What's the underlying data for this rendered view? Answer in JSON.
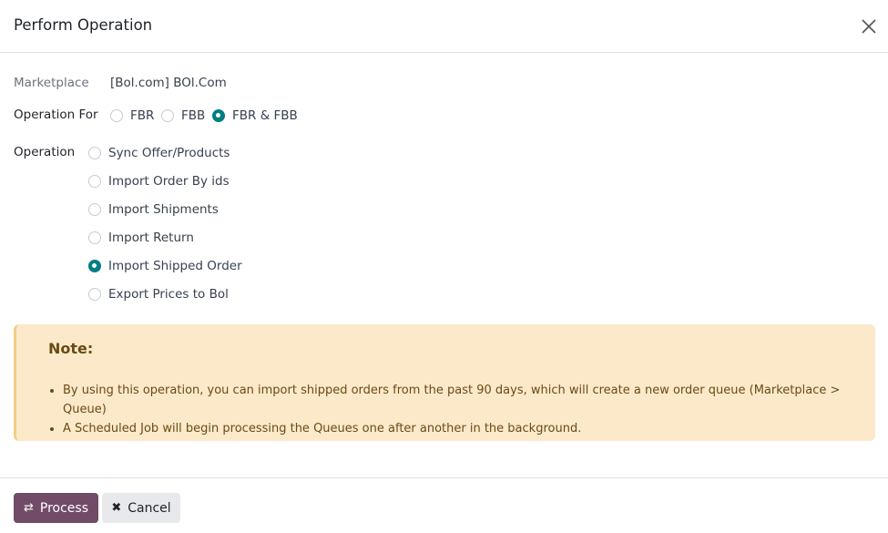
{
  "dialog": {
    "title": "Perform Operation",
    "close_icon": "close-icon"
  },
  "marketplace": {
    "label": "Marketplace",
    "value": "[Bol.com] BOl.Com"
  },
  "operation_for": {
    "label": "Operation For",
    "options": [
      {
        "label": "FBR",
        "checked": false
      },
      {
        "label": "FBB",
        "checked": false
      },
      {
        "label": "FBR & FBB",
        "checked": true
      }
    ]
  },
  "operation": {
    "label": "Operation",
    "options": [
      {
        "label": "Sync Offer/Products",
        "checked": false
      },
      {
        "label": "Import Order By ids",
        "checked": false
      },
      {
        "label": "Import Shipments",
        "checked": false
      },
      {
        "label": "Import Return",
        "checked": false
      },
      {
        "label": "Import Shipped Order",
        "checked": true
      },
      {
        "label": "Export Prices to Bol",
        "checked": false
      }
    ]
  },
  "note": {
    "title": "Note:",
    "items": [
      "By using this operation, you can import shipped orders from the past 90 days, which will create a new order queue (Marketplace > Queue)",
      "A Scheduled Job will begin processing the Queues one after another in the background."
    ]
  },
  "footer": {
    "process_label": "Process",
    "process_icon": "exchange-icon",
    "cancel_label": "Cancel",
    "cancel_icon": "x-icon"
  },
  "colors": {
    "primary": "#714b67",
    "radio_checked": "#017e84",
    "note_bg": "#fbe9ca",
    "note_text": "#6b4a14"
  }
}
